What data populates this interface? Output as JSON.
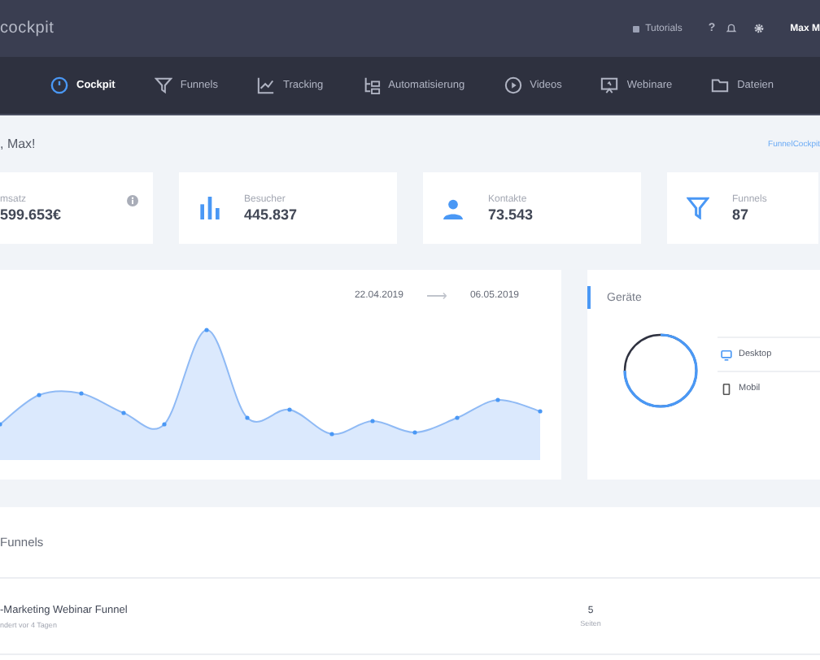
{
  "topbar": {
    "brand": "cockpit",
    "links": [
      {
        "kind": "tutorials",
        "label": "Tutorials"
      },
      {
        "kind": "help",
        "label": "?"
      }
    ],
    "user": "Max M"
  },
  "nav": [
    {
      "label": "Cockpit",
      "selected": true
    },
    {
      "label": "Funnels",
      "selected": false
    },
    {
      "label": "Tracking",
      "selected": false
    },
    {
      "label": "Automatisierung",
      "selected": false
    },
    {
      "label": "Videos",
      "selected": false
    },
    {
      "label": "Webinare",
      "selected": false
    },
    {
      "label": "Dateien",
      "selected": false
    }
  ],
  "greeting": ", Max!",
  "brand_link": "FunnelCockpit",
  "stats": [
    {
      "label": "msatz",
      "value": "599.653€",
      "info": true
    },
    {
      "label": "Besucher",
      "value": "445.837",
      "info": false
    },
    {
      "label": "Kontakte",
      "value": "73.543",
      "info": false
    },
    {
      "label": "Funnels",
      "value": "87",
      "info": false
    }
  ],
  "traffic": {
    "from": "22.04.2019",
    "to": "06.05.2019",
    "arrow": "⟶"
  },
  "devices": {
    "title": "Geräte",
    "items": [
      "Desktop",
      "Mobil"
    ]
  },
  "funnels": {
    "title": "Funnels",
    "rows": [
      {
        "name": "-Marketing Webinar Funnel",
        "changed": "ndert vor 4 Tagen",
        "count": "5",
        "count_label": "Seiten"
      }
    ]
  }
}
